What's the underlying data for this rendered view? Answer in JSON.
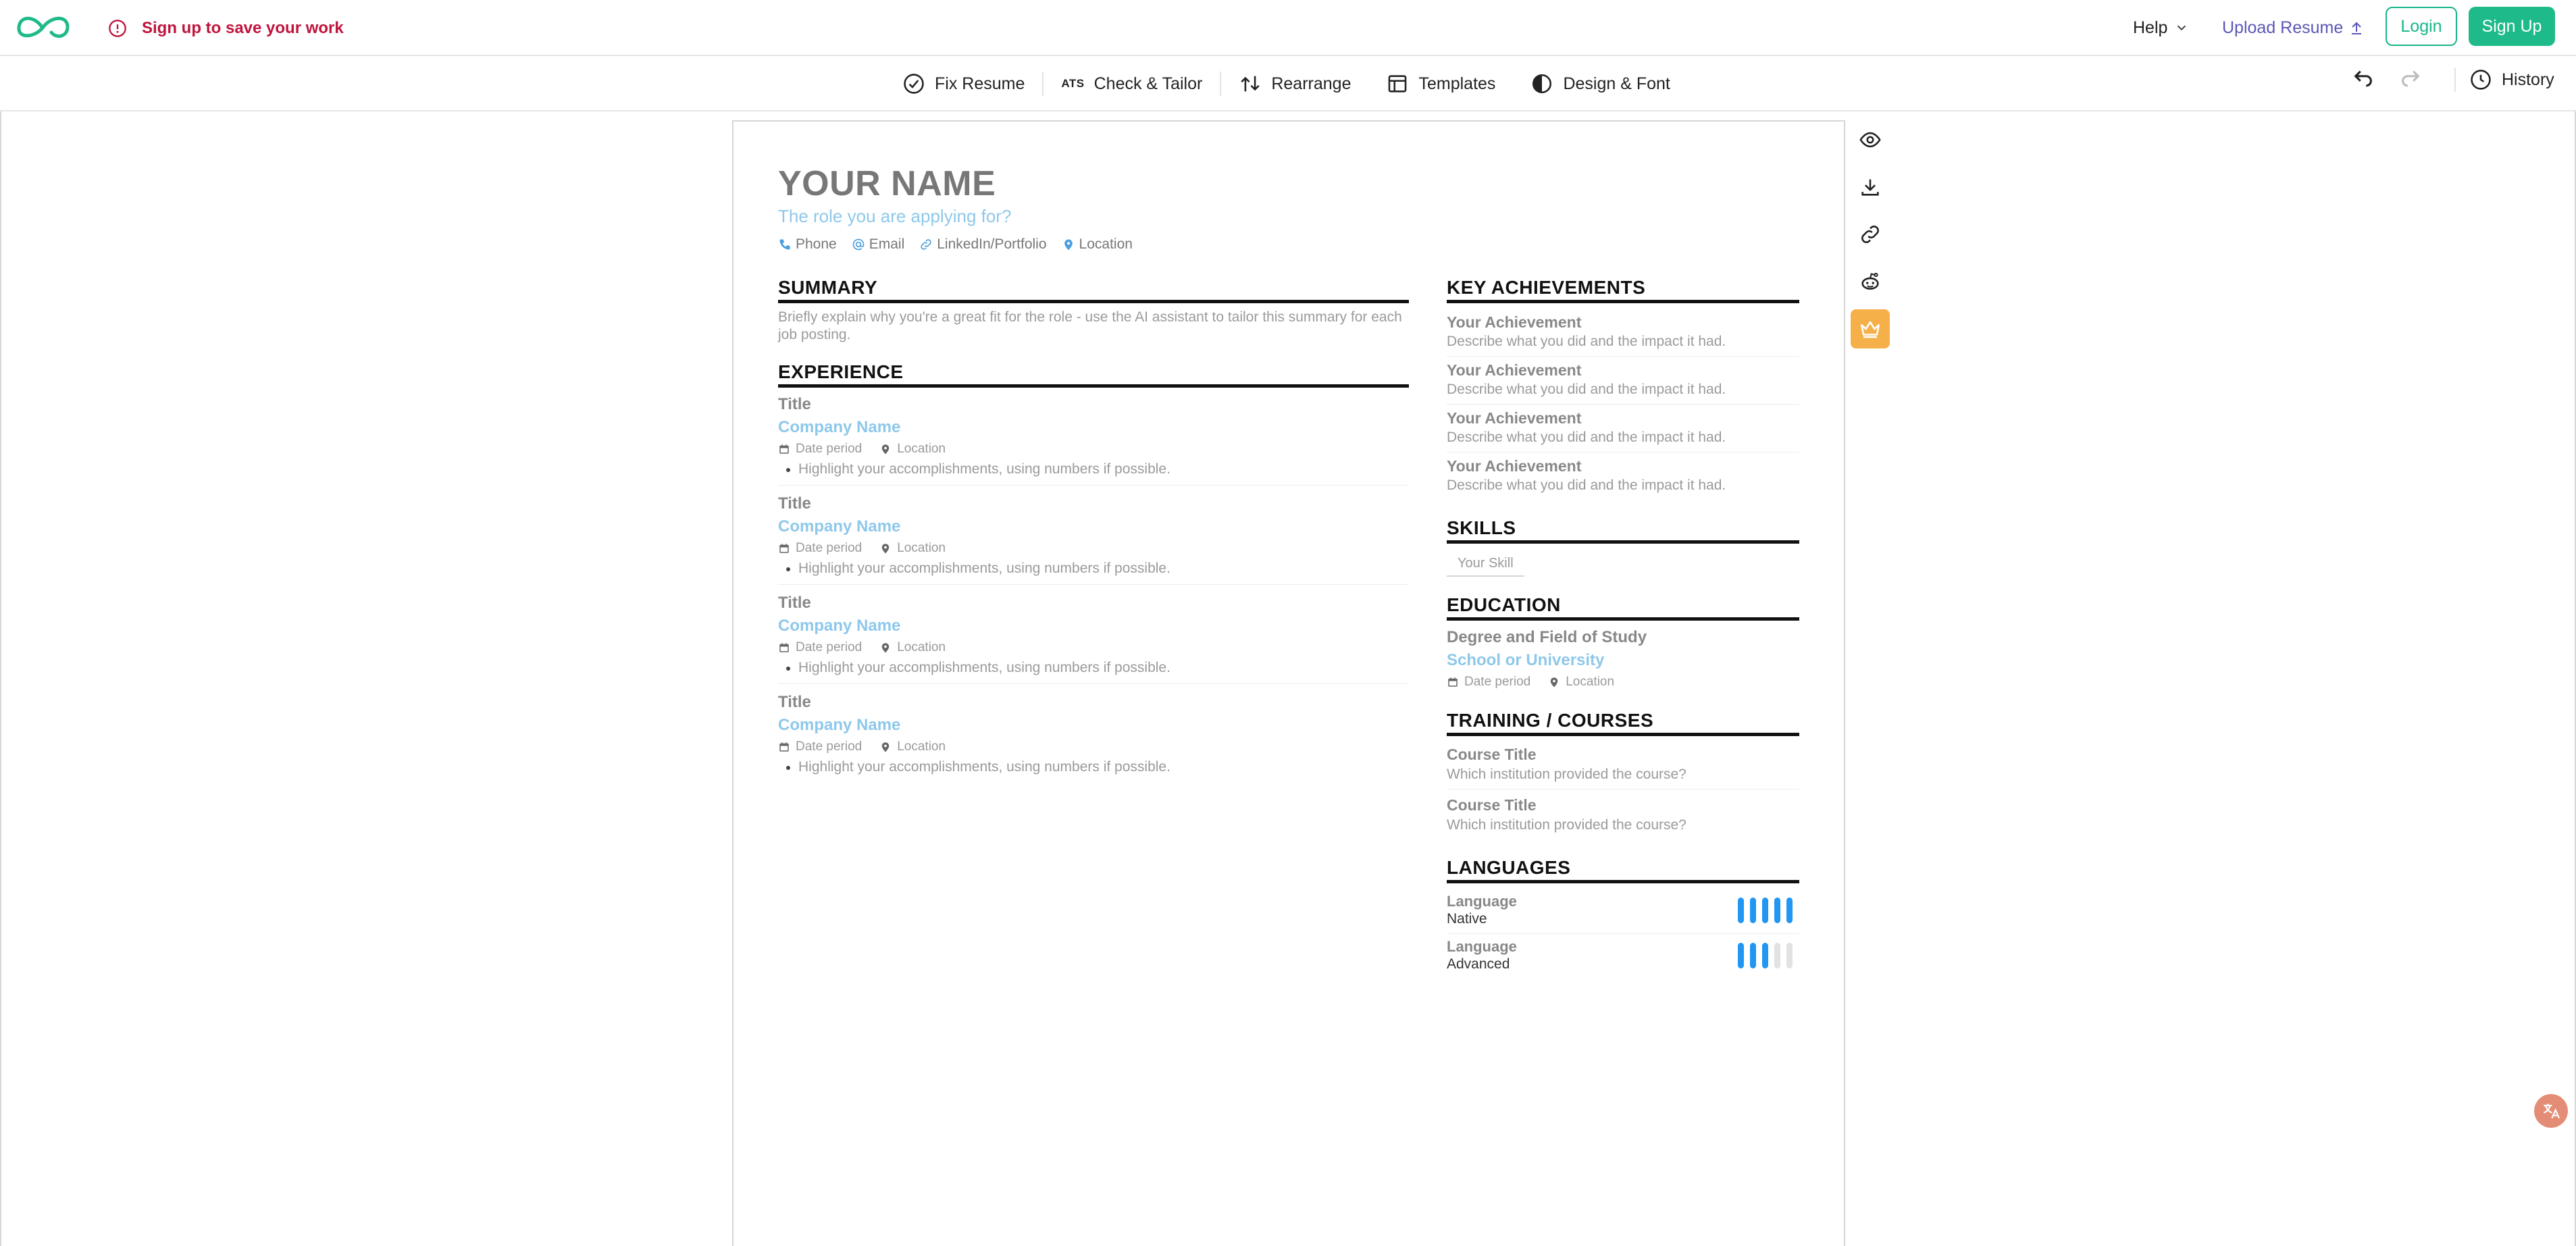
{
  "header": {
    "warning_text": "Sign up to save your work",
    "help_label": "Help",
    "upload_label": "Upload Resume",
    "login_label": "Login",
    "signup_label": "Sign Up"
  },
  "toolbar": {
    "items": [
      {
        "label": "Fix Resume",
        "icon": "check-circle-icon"
      },
      {
        "label": "Check & Tailor",
        "icon": "ats-icon",
        "badge": "ATS"
      },
      {
        "label": "Rearrange",
        "icon": "rearrange-icon"
      },
      {
        "label": "Templates",
        "icon": "templates-icon"
      },
      {
        "label": "Design & Font",
        "icon": "contrast-icon"
      }
    ],
    "history_label": "History"
  },
  "resume": {
    "name": "YOUR NAME",
    "role": "The role you are applying for?",
    "contacts": [
      "Phone",
      "Email",
      "LinkedIn/Portfolio",
      "Location"
    ],
    "summary": {
      "heading": "SUMMARY",
      "text": "Briefly explain why you're a great fit for the role - use the AI assistant to tailor this summary for each job posting."
    },
    "experience": {
      "heading": "EXPERIENCE",
      "items": [
        {
          "title": "Title",
          "company": "Company Name",
          "date": "Date period",
          "location": "Location",
          "bullet": "Highlight your accomplishments, using numbers if possible."
        },
        {
          "title": "Title",
          "company": "Company Name",
          "date": "Date period",
          "location": "Location",
          "bullet": "Highlight your accomplishments, using numbers if possible."
        },
        {
          "title": "Title",
          "company": "Company Name",
          "date": "Date period",
          "location": "Location",
          "bullet": "Highlight your accomplishments, using numbers if possible."
        },
        {
          "title": "Title",
          "company": "Company Name",
          "date": "Date period",
          "location": "Location",
          "bullet": "Highlight your accomplishments, using numbers if possible."
        }
      ]
    },
    "achievements": {
      "heading": "KEY ACHIEVEMENTS",
      "items": [
        {
          "title": "Your Achievement",
          "desc": "Describe what you did and the impact it had."
        },
        {
          "title": "Your Achievement",
          "desc": "Describe what you did and the impact it had."
        },
        {
          "title": "Your Achievement",
          "desc": "Describe what you did and the impact it had."
        },
        {
          "title": "Your Achievement",
          "desc": "Describe what you did and the impact it had."
        }
      ]
    },
    "skills": {
      "heading": "SKILLS",
      "items": [
        "Your Skill"
      ]
    },
    "education": {
      "heading": "EDUCATION",
      "degree": "Degree and Field of Study",
      "school": "School or University",
      "date": "Date period",
      "location": "Location"
    },
    "training": {
      "heading": "TRAINING / COURSES",
      "items": [
        {
          "title": "Course Title",
          "desc": "Which institution provided the course?"
        },
        {
          "title": "Course Title",
          "desc": "Which institution provided the course?"
        }
      ]
    },
    "languages": {
      "heading": "LANGUAGES",
      "items": [
        {
          "name": "Language",
          "level": "Native",
          "rating": 5,
          "max": 5
        },
        {
          "name": "Language",
          "level": "Advanced",
          "rating": 3,
          "max": 5
        }
      ]
    }
  },
  "colors": {
    "brand": "#1fba8a",
    "warning": "#c0143c",
    "accent_blue": "#8ec8ea",
    "rating_bar": "#2196f3",
    "premium": "#f6b04a"
  },
  "side_rail": [
    "eye-icon",
    "download-icon",
    "link-icon",
    "reddit-icon",
    "crown-icon"
  ]
}
